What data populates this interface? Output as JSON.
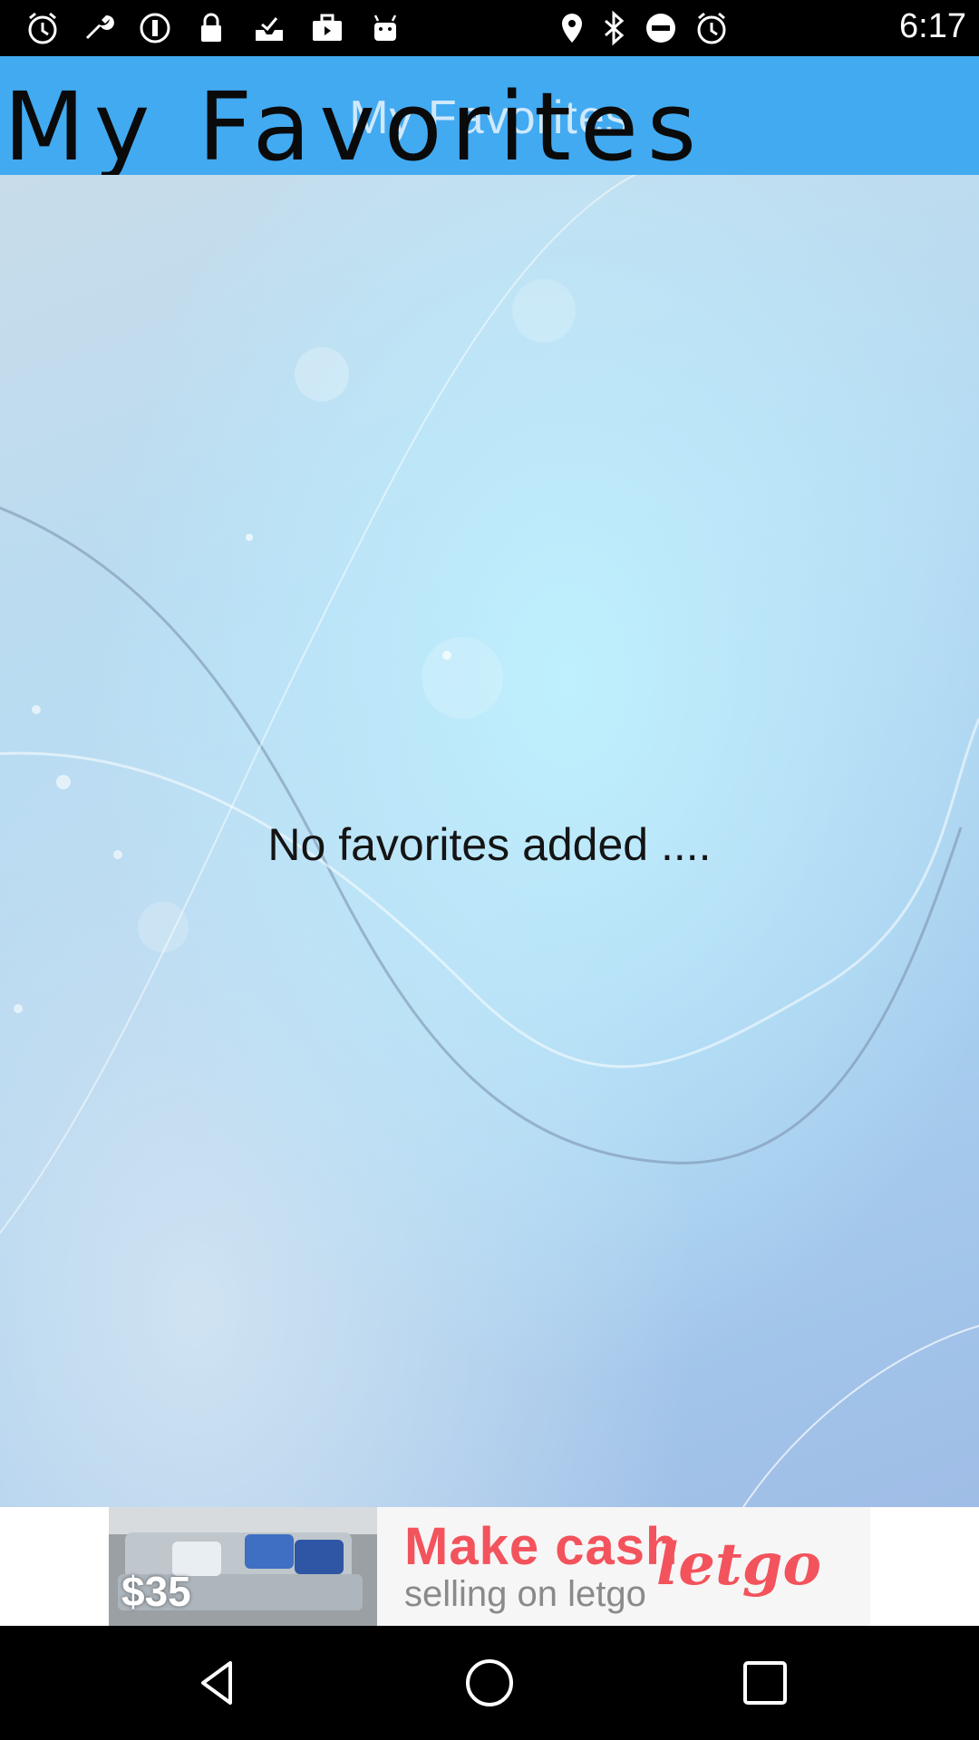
{
  "status_bar": {
    "time": "6:17",
    "left_icons": [
      "alarm-icon",
      "wrench-icon",
      "info-circle-icon",
      "lock-icon",
      "inbox-icon",
      "briefcase-icon",
      "android-icon"
    ],
    "right_icons": [
      "location-icon",
      "bluetooth-icon",
      "do-not-disturb-icon",
      "alarm-icon"
    ]
  },
  "header": {
    "title": "My Favorites",
    "overlay_title": "My Favorites",
    "color": "#42aaf1"
  },
  "main": {
    "empty_message": "No favorites added ...."
  },
  "ad": {
    "price": "$35",
    "headline": "Make cash",
    "subline": "selling on letgo",
    "brand": "letgo",
    "accent_color": "#f3535c"
  },
  "nav_bar": {
    "buttons": [
      "back-icon",
      "home-icon",
      "recents-icon"
    ]
  }
}
